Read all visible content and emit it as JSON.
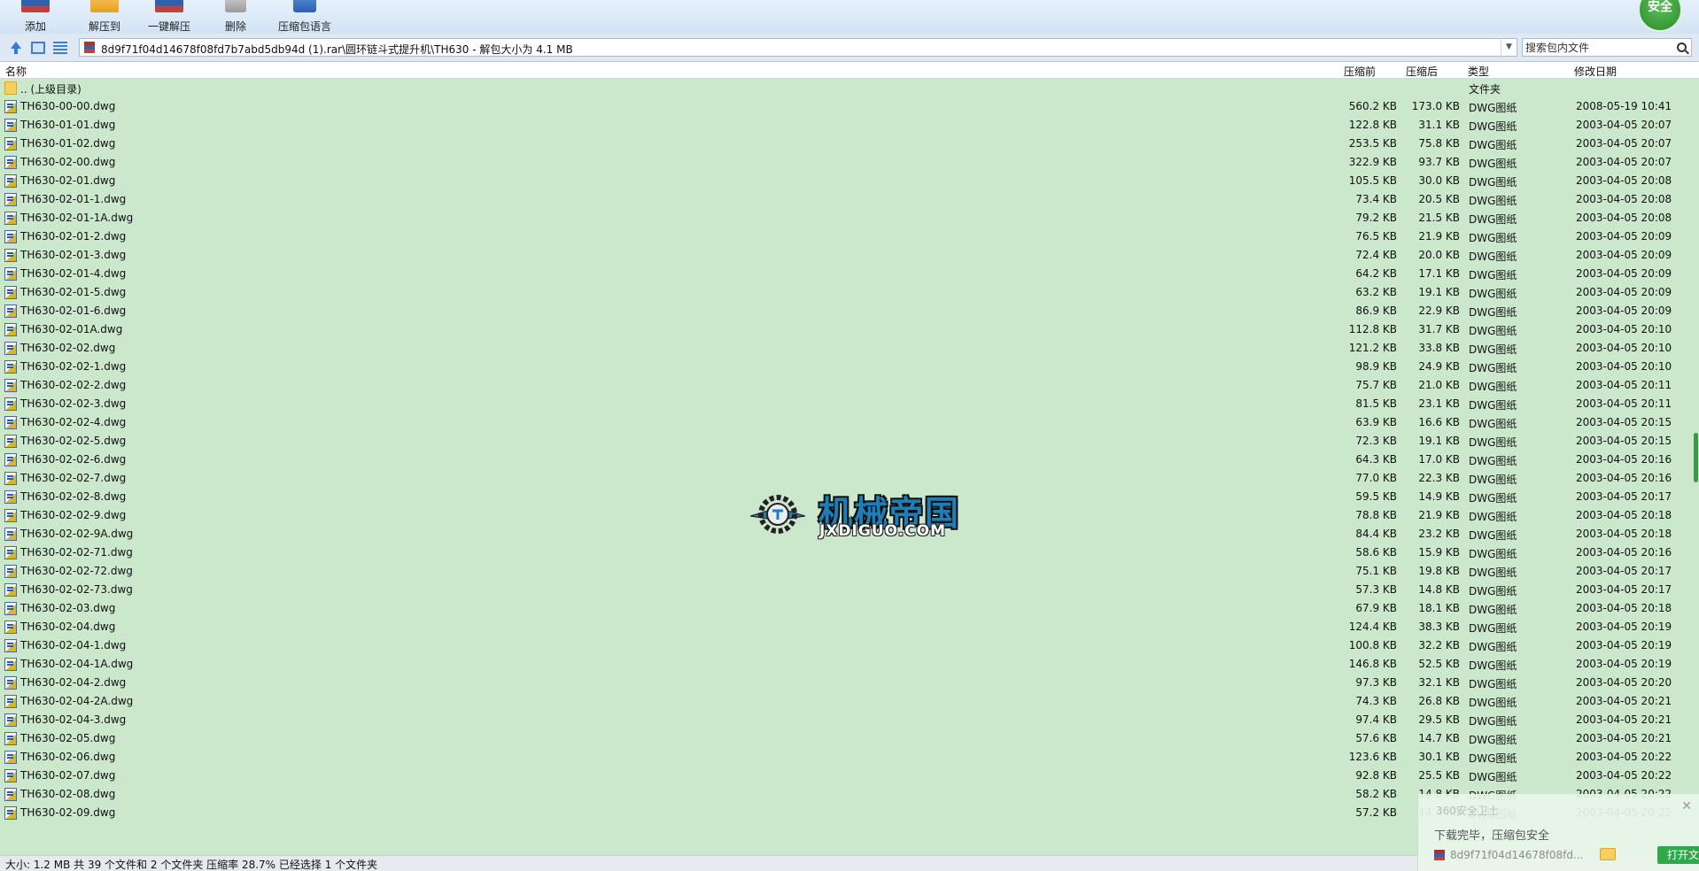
{
  "toolbar": {
    "add_label": "添加",
    "extract_to_label": "解压到",
    "one_click_label": "一键解压",
    "delete_label": "删除",
    "lang_label": "压缩包语言",
    "security_badge": "安全"
  },
  "addressbar": {
    "path": "8d9f71f04d14678f08fd7b7abd5db94d (1).rar\\圆环链斗式提升机\\TH630 - 解包大小为 4.1 MB",
    "search_placeholder": "搜索包内文件"
  },
  "columns": {
    "name": "名称",
    "packed": "压缩前",
    "unpacked": "压缩后",
    "type": "类型",
    "modified": "修改日期"
  },
  "parent_row": {
    "name": ".. (上级目录)",
    "type": "文件夹"
  },
  "files": [
    {
      "name": "TH630-00-00.dwg",
      "size": "560.2 KB",
      "packed": "173.0 KB",
      "type": "DWG图纸",
      "date": "2008-05-19 10:41"
    },
    {
      "name": "TH630-01-01.dwg",
      "size": "122.8 KB",
      "packed": "31.1 KB",
      "type": "DWG图纸",
      "date": "2003-04-05 20:07"
    },
    {
      "name": "TH630-01-02.dwg",
      "size": "253.5 KB",
      "packed": "75.8 KB",
      "type": "DWG图纸",
      "date": "2003-04-05 20:07"
    },
    {
      "name": "TH630-02-00.dwg",
      "size": "322.9 KB",
      "packed": "93.7 KB",
      "type": "DWG图纸",
      "date": "2003-04-05 20:07"
    },
    {
      "name": "TH630-02-01.dwg",
      "size": "105.5 KB",
      "packed": "30.0 KB",
      "type": "DWG图纸",
      "date": "2003-04-05 20:08"
    },
    {
      "name": "TH630-02-01-1.dwg",
      "size": "73.4 KB",
      "packed": "20.5 KB",
      "type": "DWG图纸",
      "date": "2003-04-05 20:08"
    },
    {
      "name": "TH630-02-01-1A.dwg",
      "size": "79.2 KB",
      "packed": "21.5 KB",
      "type": "DWG图纸",
      "date": "2003-04-05 20:08"
    },
    {
      "name": "TH630-02-01-2.dwg",
      "size": "76.5 KB",
      "packed": "21.9 KB",
      "type": "DWG图纸",
      "date": "2003-04-05 20:09"
    },
    {
      "name": "TH630-02-01-3.dwg",
      "size": "72.4 KB",
      "packed": "20.0 KB",
      "type": "DWG图纸",
      "date": "2003-04-05 20:09"
    },
    {
      "name": "TH630-02-01-4.dwg",
      "size": "64.2 KB",
      "packed": "17.1 KB",
      "type": "DWG图纸",
      "date": "2003-04-05 20:09"
    },
    {
      "name": "TH630-02-01-5.dwg",
      "size": "63.2 KB",
      "packed": "19.1 KB",
      "type": "DWG图纸",
      "date": "2003-04-05 20:09"
    },
    {
      "name": "TH630-02-01-6.dwg",
      "size": "86.9 KB",
      "packed": "22.9 KB",
      "type": "DWG图纸",
      "date": "2003-04-05 20:09"
    },
    {
      "name": "TH630-02-01A.dwg",
      "size": "112.8 KB",
      "packed": "31.7 KB",
      "type": "DWG图纸",
      "date": "2003-04-05 20:10"
    },
    {
      "name": "TH630-02-02.dwg",
      "size": "121.2 KB",
      "packed": "33.8 KB",
      "type": "DWG图纸",
      "date": "2003-04-05 20:10"
    },
    {
      "name": "TH630-02-02-1.dwg",
      "size": "98.9 KB",
      "packed": "24.9 KB",
      "type": "DWG图纸",
      "date": "2003-04-05 20:10"
    },
    {
      "name": "TH630-02-02-2.dwg",
      "size": "75.7 KB",
      "packed": "21.0 KB",
      "type": "DWG图纸",
      "date": "2003-04-05 20:11"
    },
    {
      "name": "TH630-02-02-3.dwg",
      "size": "81.5 KB",
      "packed": "23.1 KB",
      "type": "DWG图纸",
      "date": "2003-04-05 20:11"
    },
    {
      "name": "TH630-02-02-4.dwg",
      "size": "63.9 KB",
      "packed": "16.6 KB",
      "type": "DWG图纸",
      "date": "2003-04-05 20:15"
    },
    {
      "name": "TH630-02-02-5.dwg",
      "size": "72.3 KB",
      "packed": "19.1 KB",
      "type": "DWG图纸",
      "date": "2003-04-05 20:15"
    },
    {
      "name": "TH630-02-02-6.dwg",
      "size": "64.3 KB",
      "packed": "17.0 KB",
      "type": "DWG图纸",
      "date": "2003-04-05 20:16"
    },
    {
      "name": "TH630-02-02-7.dwg",
      "size": "77.0 KB",
      "packed": "22.3 KB",
      "type": "DWG图纸",
      "date": "2003-04-05 20:16"
    },
    {
      "name": "TH630-02-02-8.dwg",
      "size": "59.5 KB",
      "packed": "14.9 KB",
      "type": "DWG图纸",
      "date": "2003-04-05 20:17"
    },
    {
      "name": "TH630-02-02-9.dwg",
      "size": "78.8 KB",
      "packed": "21.9 KB",
      "type": "DWG图纸",
      "date": "2003-04-05 20:18"
    },
    {
      "name": "TH630-02-02-9A.dwg",
      "size": "84.4 KB",
      "packed": "23.2 KB",
      "type": "DWG图纸",
      "date": "2003-04-05 20:18"
    },
    {
      "name": "TH630-02-02-71.dwg",
      "size": "58.6 KB",
      "packed": "15.9 KB",
      "type": "DWG图纸",
      "date": "2003-04-05 20:16"
    },
    {
      "name": "TH630-02-02-72.dwg",
      "size": "75.1 KB",
      "packed": "19.8 KB",
      "type": "DWG图纸",
      "date": "2003-04-05 20:17"
    },
    {
      "name": "TH630-02-02-73.dwg",
      "size": "57.3 KB",
      "packed": "14.8 KB",
      "type": "DWG图纸",
      "date": "2003-04-05 20:17"
    },
    {
      "name": "TH630-02-03.dwg",
      "size": "67.9 KB",
      "packed": "18.1 KB",
      "type": "DWG图纸",
      "date": "2003-04-05 20:18"
    },
    {
      "name": "TH630-02-04.dwg",
      "size": "124.4 KB",
      "packed": "38.3 KB",
      "type": "DWG图纸",
      "date": "2003-04-05 20:19"
    },
    {
      "name": "TH630-02-04-1.dwg",
      "size": "100.8 KB",
      "packed": "32.2 KB",
      "type": "DWG图纸",
      "date": "2003-04-05 20:19"
    },
    {
      "name": "TH630-02-04-1A.dwg",
      "size": "146.8 KB",
      "packed": "52.5 KB",
      "type": "DWG图纸",
      "date": "2003-04-05 20:19"
    },
    {
      "name": "TH630-02-04-2.dwg",
      "size": "97.3 KB",
      "packed": "32.1 KB",
      "type": "DWG图纸",
      "date": "2003-04-05 20:20"
    },
    {
      "name": "TH630-02-04-2A.dwg",
      "size": "74.3 KB",
      "packed": "26.8 KB",
      "type": "DWG图纸",
      "date": "2003-04-05 20:21"
    },
    {
      "name": "TH630-02-04-3.dwg",
      "size": "97.4 KB",
      "packed": "29.5 KB",
      "type": "DWG图纸",
      "date": "2003-04-05 20:21"
    },
    {
      "name": "TH630-02-05.dwg",
      "size": "57.6 KB",
      "packed": "14.7 KB",
      "type": "DWG图纸",
      "date": "2003-04-05 20:21"
    },
    {
      "name": "TH630-02-06.dwg",
      "size": "123.6 KB",
      "packed": "30.1 KB",
      "type": "DWG图纸",
      "date": "2003-04-05 20:22"
    },
    {
      "name": "TH630-02-07.dwg",
      "size": "92.8 KB",
      "packed": "25.5 KB",
      "type": "DWG图纸",
      "date": "2003-04-05 20:22"
    },
    {
      "name": "TH630-02-08.dwg",
      "size": "58.2 KB",
      "packed": "14.8 KB",
      "type": "DWG图纸",
      "date": "2003-04-05 20:22"
    },
    {
      "name": "TH630-02-09.dwg",
      "size": "57.2 KB",
      "packed": "14.4 KB",
      "type": "DWG图纸",
      "date": "2003-04-05 20:22"
    }
  ],
  "watermark": {
    "cn": "机械帝国",
    "en": "JXDIGUO.COM"
  },
  "statusbar": {
    "text": "大小: 1.2 MB 共 39 个文件和 2 个文件夹 压缩率 28.7% 已经选择 1 个文件夹"
  },
  "notification": {
    "title": "360安全卫士",
    "message": "下载完毕，压缩包安全",
    "filename": "8d9f71f04d14678f08fd...",
    "open_button": "打开文件"
  }
}
